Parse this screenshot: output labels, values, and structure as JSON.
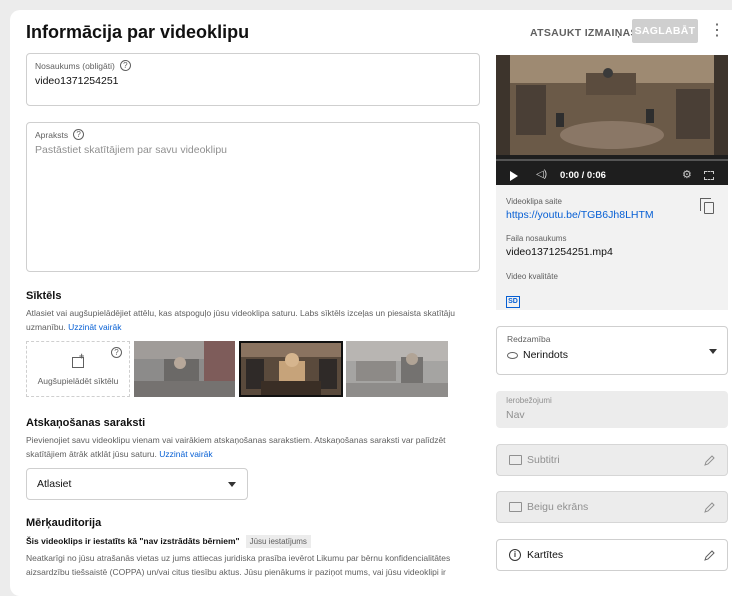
{
  "header": {
    "title": "Informācija par videoklipu",
    "undo_label": "ATSAUKT IZMAIŅAS",
    "save_label": "SAGLABĀT"
  },
  "title_field": {
    "label": "Nosaukums (obligāti)",
    "value": "video1371254251"
  },
  "description_field": {
    "label": "Apraksts",
    "placeholder": "Pastāstiet skatītājiem par savu videoklipu"
  },
  "thumbnail": {
    "heading": "Sīktēls",
    "description": "Atlasiet vai augšupielādējiet attēlu, kas atspoguļo jūsu videoklipa saturu. Labs sīktēls izceļas un piesaista skatītāju uzmanību.",
    "learn_more": "Uzzināt vairāk",
    "upload_label": "Augšupielādēt sīktēlu"
  },
  "playlists": {
    "heading": "Atskaņošanas saraksti",
    "description": "Pievienojiet savu videoklipu vienam vai vairākiem atskaņošanas sarakstiem. Atskaņošanas saraksti var palīdzēt skatītājiem ātrāk atklāt jūsu saturu.",
    "learn_more": "Uzzināt vairāk",
    "select_value": "Atlasiet"
  },
  "audience": {
    "heading": "Mērķauditorija",
    "status": "Šis videoklips ir iestatīts kā \"nav izstrādāts bērniem\"",
    "tag": "Jūsu iestatījums",
    "description": "Neatkarīgi no jūsu atrašanās vietas uz jums attiecas juridiska prasība ievērot Likumu par bērnu konfidencialitātes aizsardzību tiešsaistē (COPPA) un/vai citus tiesību aktus. Jūsu pienākums ir paziņot mums, vai jūsu videoklipi ir"
  },
  "player": {
    "time": "0:00 / 0:06"
  },
  "video_info": {
    "link_label": "Videoklipa saite",
    "link_value": "https://youtu.be/TGB6Jh8LHTM",
    "file_label": "Faila nosaukums",
    "file_value": "video1371254251.mp4",
    "quality_label": "Video kvalitāte",
    "quality_value": "SD"
  },
  "visibility": {
    "label": "Redzamība",
    "value": "Nerindots"
  },
  "restrictions": {
    "label": "Ierobežojumi",
    "value": "Nav"
  },
  "side_actions": {
    "subtitles": "Subtitri",
    "end_screen": "Beigu ekrāns",
    "cards": "Kartītes"
  },
  "colors": {
    "link": "#065fd4",
    "disabled_button": "#cfcfcf",
    "player_bg": "#2b2b2b"
  }
}
